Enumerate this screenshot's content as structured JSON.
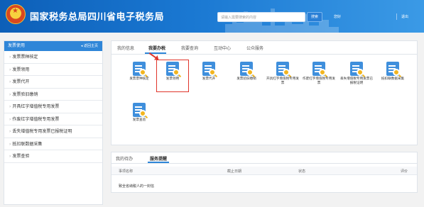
{
  "header": {
    "title": "国家税务总局四川省电子税务局",
    "search_placeholder": "请输入需要搜索的内容",
    "search_button": "搜索",
    "user_prefix": "您好",
    "logout": "退出",
    "colors": {
      "header_blue": "#1a78d2",
      "accent": "#2f86d8",
      "highlight_red": "#e0352b"
    }
  },
  "sidebar": {
    "title": "发票使用",
    "back": "返回主页",
    "items": [
      {
        "label": "发票票种核定"
      },
      {
        "label": "发票领用"
      },
      {
        "label": "发票代开"
      },
      {
        "label": "发票验旧缴销"
      },
      {
        "label": "开具红字增值税专用发票"
      },
      {
        "label": "作废红字增值税专用发票"
      },
      {
        "label": "丢失增值税专用发票已报税证明"
      },
      {
        "label": "抵扣联数据采集"
      },
      {
        "label": "发票查验"
      }
    ]
  },
  "main": {
    "tabs": [
      {
        "label": "我的信息"
      },
      {
        "label": "我要办税",
        "active": true
      },
      {
        "label": "我要查询"
      },
      {
        "label": "互动中心"
      },
      {
        "label": "公众服务"
      }
    ],
    "tiles": [
      {
        "label": "发票票种核定",
        "icon": "invoice-search-icon"
      },
      {
        "label": "发票领用",
        "icon": "invoice-search-icon",
        "selected": true
      },
      {
        "label": "发票代开",
        "icon": "invoice-search-icon"
      },
      {
        "label": "发票验旧缴销",
        "icon": "invoice-search-icon"
      },
      {
        "label": "开具红字增值税专用发票",
        "icon": "invoice-search-icon"
      },
      {
        "label": "作废红字增值税专用发票",
        "icon": "invoice-search-icon"
      },
      {
        "label": "丢失增值税专用发票已报税证明",
        "icon": "invoice-search-icon"
      },
      {
        "label": "抵扣联数据采集",
        "icon": "invoice-search-icon"
      },
      {
        "label": "发票查验",
        "icon": "invoice-search-icon"
      }
    ]
  },
  "todo": {
    "tabs": [
      {
        "label": "我的待办"
      },
      {
        "label": "服务提醒",
        "active": true
      }
    ],
    "columns": [
      "事项名称",
      "截止日期",
      "状态",
      "评价"
    ],
    "rows": [
      {
        "name": "致全省纳税人的一封信"
      }
    ]
  }
}
